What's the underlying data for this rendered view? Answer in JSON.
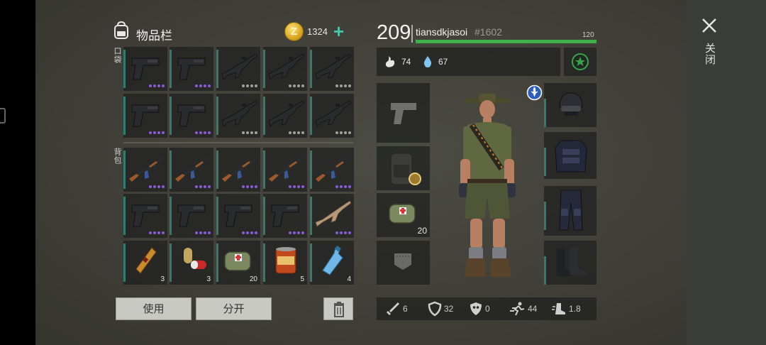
{
  "inventory": {
    "title": "物品栏",
    "currency_icon_letter": "Z",
    "currency": "1324",
    "add_label": "+",
    "pocket_label": "口袋",
    "backpack_label": "背包",
    "slots": [
      {
        "icon": "pistol",
        "rarity": "epic",
        "quantity": ""
      },
      {
        "icon": "pistol",
        "rarity": "epic",
        "quantity": ""
      },
      {
        "icon": "m16-rifle",
        "rarity": "common",
        "quantity": ""
      },
      {
        "icon": "m16-rifle",
        "rarity": "common",
        "quantity": ""
      },
      {
        "icon": "m16-rifle",
        "rarity": "common",
        "quantity": ""
      },
      {
        "icon": "pistol",
        "rarity": "epic",
        "quantity": ""
      },
      {
        "icon": "pistol",
        "rarity": "epic",
        "quantity": ""
      },
      {
        "icon": "m16-rifle",
        "rarity": "common",
        "quantity": ""
      },
      {
        "icon": "m16-rifle",
        "rarity": "common",
        "quantity": ""
      },
      {
        "icon": "m16-rifle",
        "rarity": "common",
        "quantity": ""
      },
      {
        "icon": "ak47-rifle",
        "rarity": "epic",
        "quantity": ""
      },
      {
        "icon": "ak47-rifle",
        "rarity": "epic",
        "quantity": ""
      },
      {
        "icon": "ak47-rifle",
        "rarity": "epic",
        "quantity": ""
      },
      {
        "icon": "ak47-rifle",
        "rarity": "epic",
        "quantity": ""
      },
      {
        "icon": "ak47-rifle",
        "rarity": "epic",
        "quantity": ""
      },
      {
        "icon": "pistol",
        "rarity": "epic",
        "quantity": ""
      },
      {
        "icon": "pistol",
        "rarity": "epic",
        "quantity": ""
      },
      {
        "icon": "pistol",
        "rarity": "epic",
        "quantity": ""
      },
      {
        "icon": "pistol",
        "rarity": "epic",
        "quantity": ""
      },
      {
        "icon": "tan-assault-rifle",
        "rarity": "epic",
        "quantity": ""
      },
      {
        "icon": "stimulant-ampoule",
        "rarity": "none",
        "quantity": "3"
      },
      {
        "icon": "pill-capsule",
        "rarity": "none",
        "quantity": "3"
      },
      {
        "icon": "first-aid-kit",
        "rarity": "none",
        "quantity": "20"
      },
      {
        "icon": "canned-food",
        "rarity": "none",
        "quantity": "5"
      },
      {
        "icon": "water-bottle",
        "rarity": "none",
        "quantity": "4"
      }
    ],
    "use_button": "使用",
    "split_button": "分开"
  },
  "player": {
    "level": "209",
    "name": "tiansdkjasoi",
    "id": "#1602",
    "xp_max": "120",
    "xp_fraction": 1.0,
    "hunger": "74",
    "thirst": "67",
    "quick_slots": [
      {
        "icon": "pistol-silhouette",
        "quantity": ""
      },
      {
        "icon": "backpack",
        "quantity": ""
      },
      {
        "icon": "first-aid-kit",
        "quantity": "20"
      },
      {
        "icon": "pocket",
        "quantity": ""
      }
    ],
    "armor_slots": [
      "helmet",
      "body-armor",
      "pants",
      "boots"
    ],
    "stats": [
      {
        "icon": "sword-icon",
        "value": "6"
      },
      {
        "icon": "shield-icon",
        "value": "32"
      },
      {
        "icon": "skull-shield-icon",
        "value": "0"
      },
      {
        "icon": "running-icon",
        "value": "44"
      },
      {
        "icon": "boot-icon",
        "value": "1.8"
      }
    ]
  },
  "close_label": "关闭",
  "colors": {
    "accent_teal": "#2f7c73",
    "xp_green": "#3fb04b",
    "rarity_epic": "#8b5bd8",
    "rarity_common": "#a0a0a0",
    "coin_gold": "#d9a521",
    "plus_teal": "#47c6a8"
  }
}
